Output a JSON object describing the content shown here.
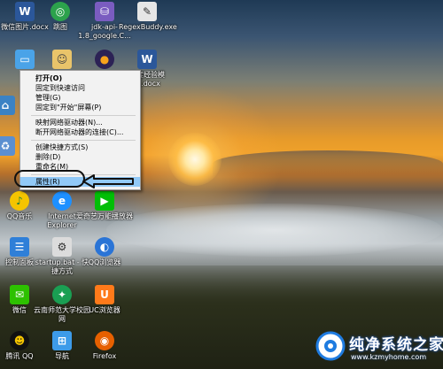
{
  "desktop_icons": {
    "word_doc_1": "微信图片.docx",
    "tiaotu": "跳图",
    "jdk": "jdk-api-1.8_google.C...",
    "regexbuddy": "RegexBuddy.exe",
    "word_doc_2": "百度经验模板.docx",
    "qq_music": "QQ音乐",
    "ie": "Internet Explorer",
    "iqiyi": "爱奇艺万能播放器",
    "control_panel": "控制面板",
    "startup_bat": "startup.bat - 快捷方式",
    "qq_browser": "QQ浏览器",
    "wechat": "微信",
    "yunnan_app": "云南师范大学校园网",
    "uc_browser": "UC浏览器",
    "qq": "腾讯 QQ",
    "nav": "导航",
    "firefox": "Firefox"
  },
  "context_menu": {
    "items": [
      "打开(O)",
      "固定到快速访问",
      "管理(G)",
      "固定到\"开始\"屏幕(P)",
      "映射网络驱动器(N)...",
      "断开网络驱动器的连接(C)...",
      "创建快捷方式(S)",
      "删除(D)",
      "重命名(M)",
      "属性(R)"
    ],
    "highlighted_item": "属性(R)",
    "highlight_color": "#91c9f7"
  },
  "watermark": {
    "title": "纯净系统之家",
    "url": "www.kzmyhome.com"
  },
  "colors": {
    "accent_blue": "#2a74d6",
    "annotation": "#111111"
  }
}
